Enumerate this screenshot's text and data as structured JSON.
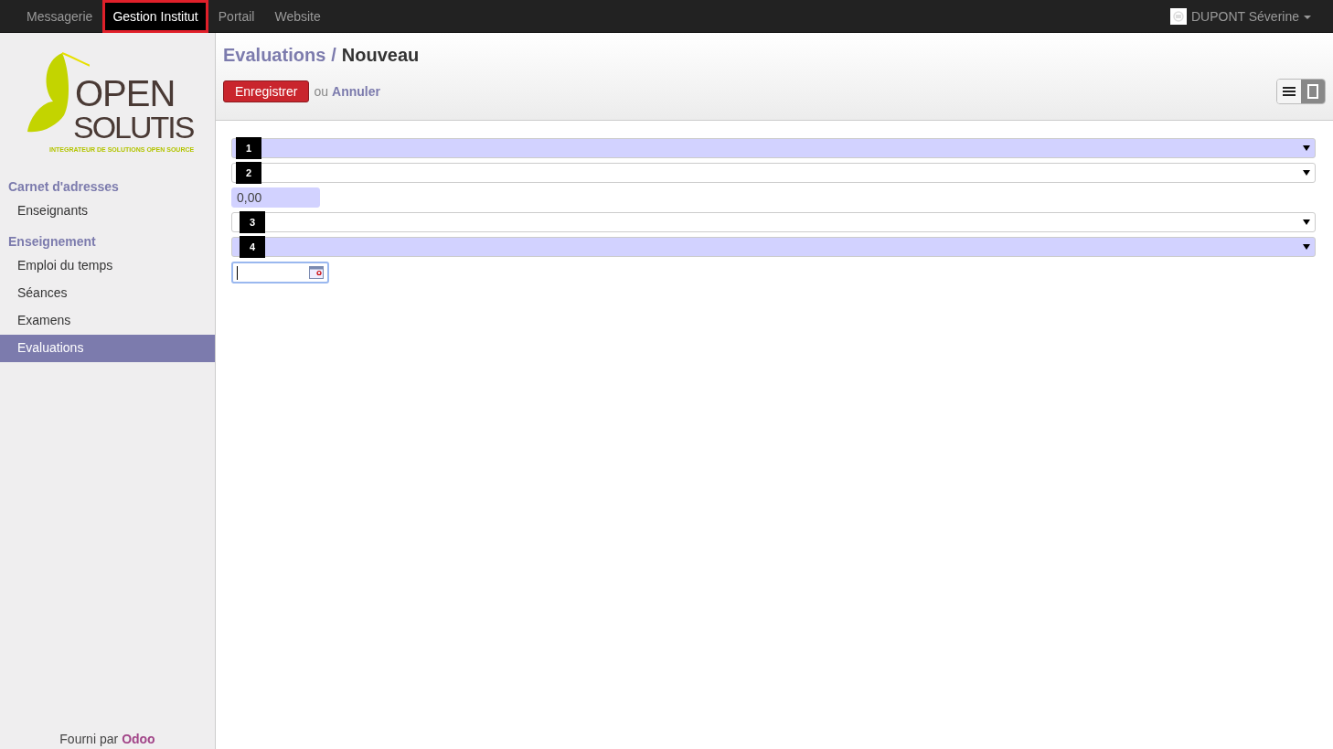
{
  "top_menu": [
    {
      "label": "Messagerie",
      "selected": false
    },
    {
      "label": "Gestion Institut",
      "selected": true
    },
    {
      "label": "Portail",
      "selected": false
    },
    {
      "label": "Website",
      "selected": false
    }
  ],
  "user": {
    "name": "DUPONT Séverine"
  },
  "logo": {
    "line_1": "OPEN",
    "line_2": "SOLUTIS",
    "tagline": "INTEGRATEUR DE SOLUTIONS OPEN SOURCE"
  },
  "sidebar": {
    "sections": [
      {
        "title": "Carnet d'adresses",
        "items": [
          {
            "label": "Enseignants",
            "selected": false
          }
        ]
      },
      {
        "title": "Enseignement",
        "items": [
          {
            "label": "Emploi du temps",
            "selected": false
          },
          {
            "label": "Séances",
            "selected": false
          },
          {
            "label": "Examens",
            "selected": false
          },
          {
            "label": "Evaluations",
            "selected": true
          }
        ]
      }
    ],
    "footer": {
      "prefix": "Fourni par",
      "link": "Odoo"
    }
  },
  "breadcrumb": {
    "parent": "Evaluations",
    "separator": "/",
    "current": "Nouveau"
  },
  "actions": {
    "save": "Enregistrer",
    "or": "ou",
    "cancel": "Annuler"
  },
  "view_switcher": [
    {
      "kind": "list",
      "selected": false
    },
    {
      "kind": "form",
      "selected": true
    }
  ],
  "fields": [
    {
      "kind": "select",
      "required": true,
      "marker": "1"
    },
    {
      "kind": "select",
      "required": false,
      "marker": "2"
    },
    {
      "kind": "number",
      "required": true,
      "value": "0,00"
    },
    {
      "kind": "select",
      "required": false,
      "marker": "3"
    },
    {
      "kind": "select",
      "required": true,
      "marker": "4"
    },
    {
      "kind": "date",
      "required": false,
      "focused": true
    }
  ]
}
